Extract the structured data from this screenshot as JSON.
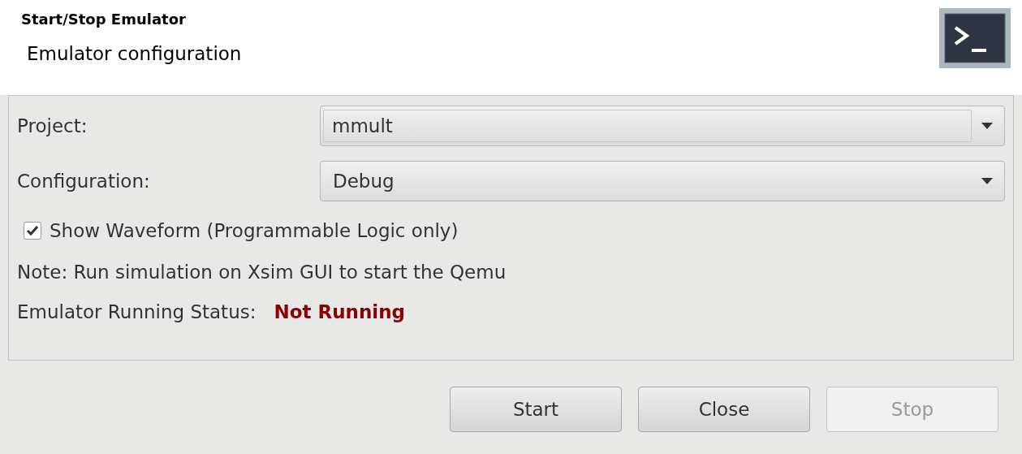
{
  "header": {
    "title": "Start/Stop Emulator",
    "subtitle": "Emulator configuration"
  },
  "fields": [
    {
      "label": "Project:",
      "value": "mmult",
      "focused": true
    },
    {
      "label": "Configuration:",
      "value": "Debug",
      "focused": false
    }
  ],
  "checkbox": {
    "label": "Show Waveform (Programmable Logic only)",
    "checked": true
  },
  "note": "Note: Run simulation on Xsim GUI to start the Qemu",
  "status": {
    "label": "Emulator Running Status:",
    "value": "Not Running"
  },
  "buttons": [
    {
      "label": "Start",
      "disabled": false
    },
    {
      "label": "Close",
      "disabled": false
    },
    {
      "label": "Stop",
      "disabled": true
    }
  ]
}
